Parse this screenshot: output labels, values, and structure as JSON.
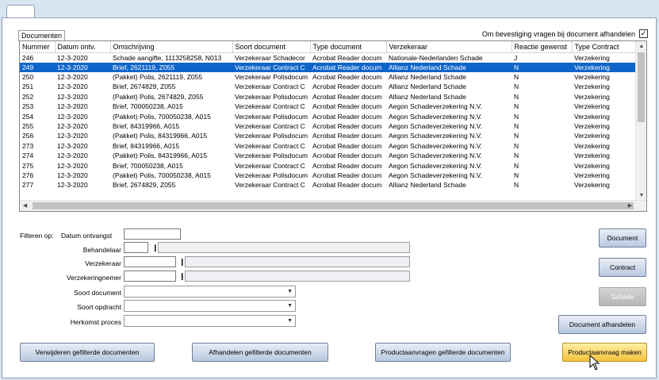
{
  "group_label": "Documenten",
  "confirm_label": "Om bevestiging vragen bij document afhandelen",
  "confirm_checked": "✓",
  "columns": [
    "Nummer",
    "Datum ontv.",
    "Omschrijving",
    "Soort document",
    "Type document",
    "Verzekeraar",
    "Reactie gewenst",
    "Type Contract"
  ],
  "rows": [
    [
      "246",
      "12-3-2020",
      "Schade aangifte, 1113258258, N013",
      "Verzekeraar Schadecor",
      "Acrobat Reader docum",
      "Nationale-Nederlanden Schade",
      "J",
      "Verzekering"
    ],
    [
      "249",
      "12-3-2020",
      "Brief, 2621119, Z055",
      "Verzekeraar Contract C",
      "Acrobat Reader docum",
      "Allianz Nederland Schade",
      "N",
      "Verzekering"
    ],
    [
      "250",
      "12-3-2020",
      "(Pakket) Polis, 2621119, Z055",
      "Verzekeraar Polisdocum",
      "Acrobat Reader docum",
      "Allianz Nederland Schade",
      "N",
      "Verzekering"
    ],
    [
      "251",
      "12-3-2020",
      "Brief, 2674829, Z055",
      "Verzekeraar Contract C",
      "Acrobat Reader docum",
      "Allianz Nederland Schade",
      "N",
      "Verzekering"
    ],
    [
      "252",
      "12-3-2020",
      "(Pakket) Polis, 2674829, Z055",
      "Verzekeraar Polisdocum",
      "Acrobat Reader docum",
      "Allianz Nederland Schade",
      "N",
      "Verzekering"
    ],
    [
      "253",
      "12-3-2020",
      "Brief, 700050238, A015",
      "Verzekeraar Contract C",
      "Acrobat Reader docum",
      "Aegon Schadeverzekering N.V.",
      "N",
      "Verzekering"
    ],
    [
      "254",
      "12-3-2020",
      "(Pakket) Polis, 700050238, A015",
      "Verzekeraar Polisdocum",
      "Acrobat Reader docum",
      "Aegon Schadeverzekering N.V.",
      "N",
      "Verzekering"
    ],
    [
      "255",
      "12-3-2020",
      "Brief, 84319966, A015",
      "Verzekeraar Contract C",
      "Acrobat Reader docum",
      "Aegon Schadeverzekering N.V.",
      "N",
      "Verzekering"
    ],
    [
      "256",
      "12-3-2020",
      "(Pakket) Polis, 84319966, A015",
      "Verzekeraar Polisdocum",
      "Acrobat Reader docum",
      "Aegon Schadeverzekering N.V.",
      "N",
      "Verzekering"
    ],
    [
      "273",
      "12-3-2020",
      "Brief, 84319966, A015",
      "Verzekeraar Contract C",
      "Acrobat Reader docum",
      "Aegon Schadeverzekering N.V.",
      "N",
      "Verzekering"
    ],
    [
      "274",
      "12-3-2020",
      "(Pakket) Polis, 84319966, A015",
      "Verzekeraar Polisdocum",
      "Acrobat Reader docum",
      "Aegon Schadeverzekering N.V.",
      "N",
      "Verzekering"
    ],
    [
      "275",
      "12-3-2020",
      "Brief, 700050238, A015",
      "Verzekeraar Contract C",
      "Acrobat Reader docum",
      "Aegon Schadeverzekering N.V.",
      "N",
      "Verzekering"
    ],
    [
      "276",
      "12-3-2020",
      "(Pakket) Polis, 700050238, A015",
      "Verzekeraar Polisdocum",
      "Acrobat Reader docum",
      "Aegon Schadeverzekering N.V.",
      "N",
      "Verzekering"
    ],
    [
      "277",
      "12-3-2020",
      "Brief, 2674829, Z055",
      "Verzekeraar Contract C",
      "Acrobat Reader docum",
      "Allianz Nederland Schade",
      "N",
      "Verzekering"
    ]
  ],
  "selected_row": 1,
  "filter": {
    "title": "Filteren op:",
    "date_label": "Datum ontvangst",
    "handler_label": "Behandelaar",
    "insurer_label": "Verzekeraar",
    "policyholder_label": "Verzekeringnemer",
    "doc_type_label": "Soort document",
    "order_type_label": "Soort opdracht",
    "origin_label": "Herkomst proces"
  },
  "buttons": {
    "document": "Document",
    "contract": "Contract",
    "schade": "Schade",
    "handle_document": "Document afhandelen",
    "delete_filtered": "Verwijderen gefilterde documenten",
    "handle_filtered": "Afhandelen gefilterde documenten",
    "product_requests_filtered": "Productaanvragen gefilterde documenten",
    "make_product_request": "Productaanvraag maken"
  },
  "colors": {
    "selection": "#0f65c9",
    "hot_button": "#f4c23b",
    "background": "#d9e4f1"
  }
}
